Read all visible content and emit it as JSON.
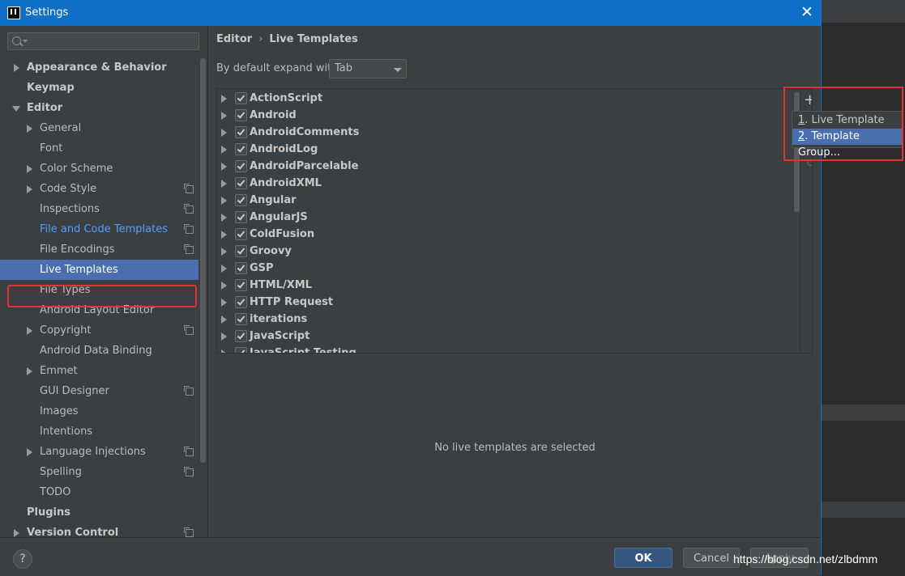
{
  "window": {
    "title": "Settings",
    "close_glyph": "✕"
  },
  "breadcrumb": {
    "parent": "Editor",
    "separator": "›",
    "current": "Live Templates"
  },
  "expand": {
    "label": "By default expand with",
    "value": "Tab"
  },
  "sidebar": {
    "items": [
      {
        "label": "Appearance & Behavior"
      },
      {
        "label": "Keymap"
      },
      {
        "label": "Editor"
      },
      {
        "label": "General"
      },
      {
        "label": "Font"
      },
      {
        "label": "Color Scheme"
      },
      {
        "label": "Code Style"
      },
      {
        "label": "Inspections"
      },
      {
        "label": "File and Code Templates"
      },
      {
        "label": "File Encodings"
      },
      {
        "label": "Live Templates"
      },
      {
        "label": "File Types"
      },
      {
        "label": "Android Layout Editor"
      },
      {
        "label": "Copyright"
      },
      {
        "label": "Android Data Binding"
      },
      {
        "label": "Emmet"
      },
      {
        "label": "GUI Designer"
      },
      {
        "label": "Images"
      },
      {
        "label": "Intentions"
      },
      {
        "label": "Language Injections"
      },
      {
        "label": "Spelling"
      },
      {
        "label": "TODO"
      },
      {
        "label": "Plugins"
      },
      {
        "label": "Version Control"
      }
    ]
  },
  "template_groups": [
    "ActionScript",
    "Android",
    "AndroidComments",
    "AndroidLog",
    "AndroidParcelable",
    "AndroidXML",
    "Angular",
    "AngularJS",
    "ColdFusion",
    "Groovy",
    "GSP",
    "HTML/XML",
    "HTTP Request",
    "iterations",
    "JavaScript",
    "JavaScript Testing"
  ],
  "toolbar": {
    "add_glyph": "+",
    "undo_glyph": "↺"
  },
  "add_menu": {
    "options": [
      {
        "number": "1",
        "label": ". Live Template"
      },
      {
        "number": "2",
        "label": ". Template Group..."
      }
    ]
  },
  "empty_message": "No live templates are selected",
  "buttons": {
    "help": "?",
    "ok": "OK",
    "cancel": "Cancel",
    "apply": "Apply"
  },
  "watermark": "https://blog.csdn.net/zlbdmm"
}
